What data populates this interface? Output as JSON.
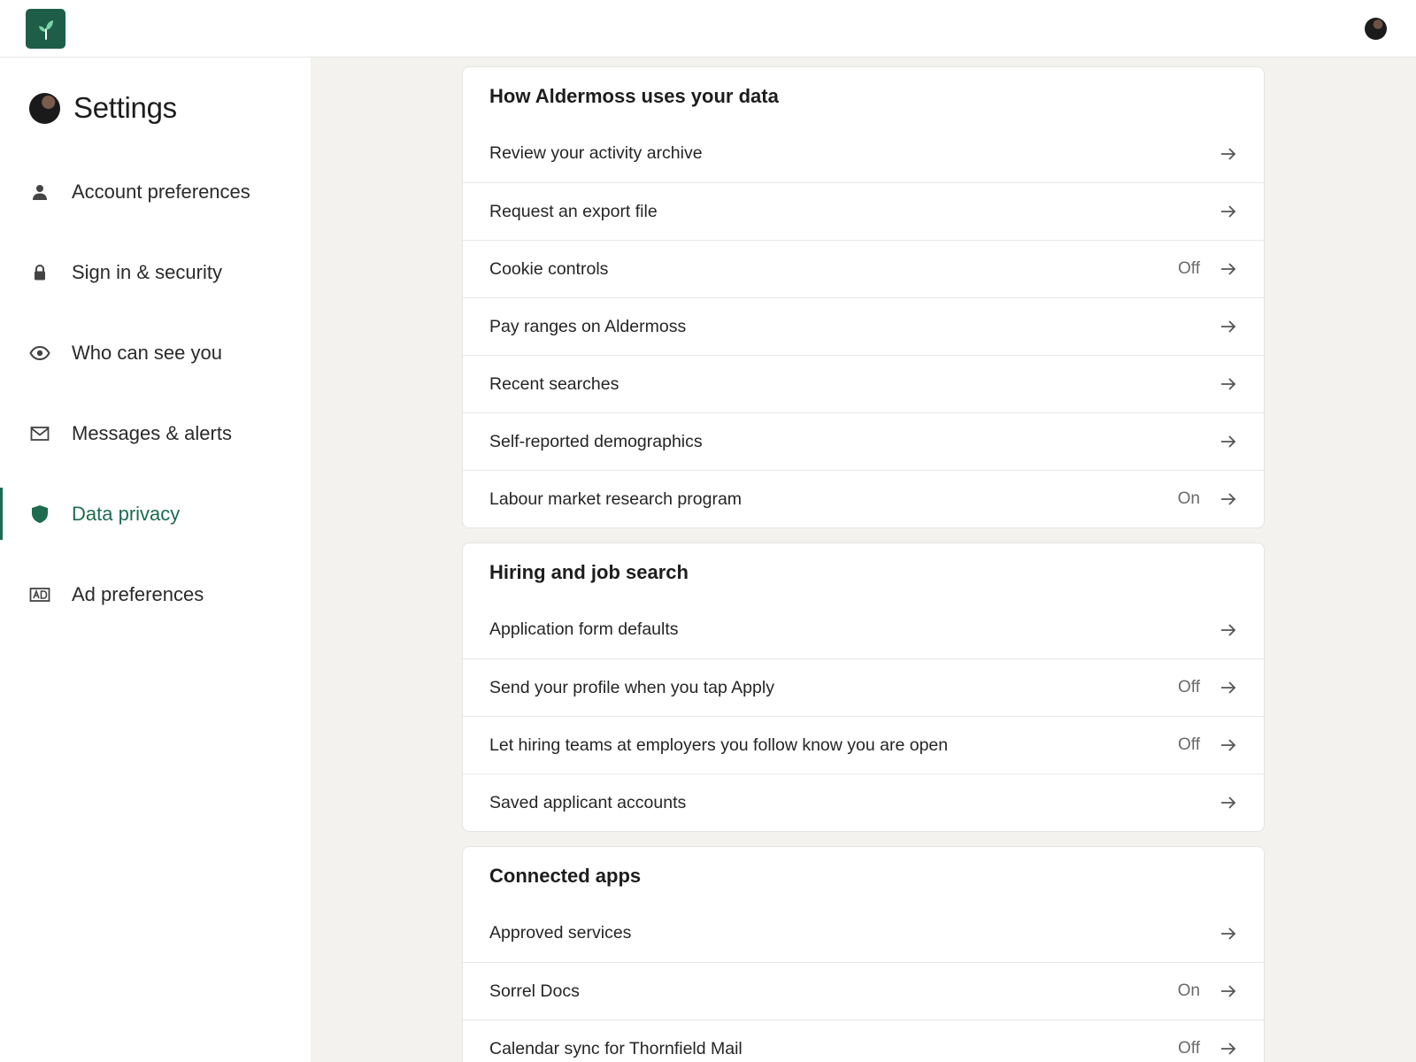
{
  "header": {
    "logo_icon": "sprout-logo-icon",
    "avatar": "user-avatar"
  },
  "sidebar": {
    "title": "Settings",
    "items": [
      {
        "label": "Account preferences",
        "icon": "person-icon",
        "active": false
      },
      {
        "label": "Sign in & security",
        "icon": "lock-icon",
        "active": false
      },
      {
        "label": "Who can see you",
        "icon": "eye-icon",
        "active": false
      },
      {
        "label": "Messages & alerts",
        "icon": "envelope-icon",
        "active": false
      },
      {
        "label": "Data privacy",
        "icon": "shield-icon",
        "active": true
      },
      {
        "label": "Ad preferences",
        "icon": "ad-icon",
        "active": false
      }
    ]
  },
  "sections": [
    {
      "title": "How Aldermoss uses your data",
      "rows": [
        {
          "label": "Review your activity archive",
          "status": ""
        },
        {
          "label": "Request an export file",
          "status": ""
        },
        {
          "label": "Cookie controls",
          "status": "Off"
        },
        {
          "label": "Pay ranges on Aldermoss",
          "status": ""
        },
        {
          "label": "Recent searches",
          "status": ""
        },
        {
          "label": "Self-reported demographics",
          "status": ""
        },
        {
          "label": "Labour market research program",
          "status": "On"
        }
      ]
    },
    {
      "title": "Hiring and job search",
      "rows": [
        {
          "label": "Application form defaults",
          "status": ""
        },
        {
          "label": "Send your profile when you tap Apply",
          "status": "Off"
        },
        {
          "label": "Let hiring teams at employers you follow know you are open",
          "status": "Off"
        },
        {
          "label": "Saved applicant accounts",
          "status": ""
        }
      ]
    },
    {
      "title": "Connected apps",
      "rows": [
        {
          "label": "Approved services",
          "status": ""
        },
        {
          "label": "Sorrel Docs",
          "status": "On"
        },
        {
          "label": "Calendar sync for Thornfield Mail",
          "status": "Off"
        }
      ]
    }
  ],
  "colors": {
    "accent": "#1e6b4f",
    "brand": "#1e5e48",
    "background": "#f3f2ef"
  }
}
